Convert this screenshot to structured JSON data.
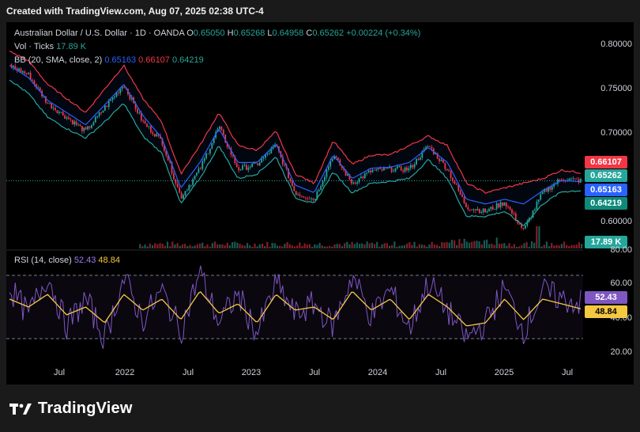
{
  "header": {
    "created_text": "Created with TradingView.com, Aug 07, 2025 02:38 UTC-4"
  },
  "legend": {
    "title": "Australian Dollar / U.S. Dollar · 1D · OANDA",
    "o_label": "O",
    "o_value": "0.65050",
    "h_label": "H",
    "h_value": "0.65268",
    "l_label": "L",
    "l_value": "0.64958",
    "c_label": "C",
    "c_value": "0.65262",
    "change": "+0.00224 (+0.34%)",
    "vol_label": "Vol · Ticks",
    "vol_value": "17.89 K",
    "bb_label": "BB (20, SMA, close, 2)",
    "bb_basis": "0.65163",
    "bb_upper": "0.66107",
    "bb_lower": "0.64219",
    "rsi_label": "RSI (14, close)",
    "rsi_value": "52.43",
    "rsi_ma": "48.84"
  },
  "price_axis": [
    "0.80000",
    "0.75000",
    "0.70000",
    "0.60000"
  ],
  "price_tags": {
    "upper": "0.66107",
    "close": "0.65262",
    "basis": "0.65163",
    "lower": "0.64219",
    "volume": "17.89 K"
  },
  "rsi_axis": [
    "80.00",
    "60.00",
    "40.00",
    "20.00"
  ],
  "rsi_tags": {
    "rsi": "52.43",
    "ma": "48.84"
  },
  "time_axis": [
    "Jul",
    "2022",
    "Jul",
    "2023",
    "Jul",
    "2024",
    "Jul",
    "2025",
    "Jul"
  ],
  "footer": {
    "brand": "TradingView"
  },
  "colors": {
    "up": "#26a69a",
    "down": "#f23645",
    "basis": "#2962ff",
    "rsi": "#7e57c2",
    "rsi_ma": "#f5c842",
    "bg": "#000000"
  },
  "chart_data": [
    {
      "type": "line",
      "title": "Australian Dollar / U.S. Dollar · 1D · OANDA",
      "x": [
        "2021-05",
        "2021-07",
        "2021-09",
        "2021-11",
        "2022-01",
        "2022-03",
        "2022-04",
        "2022-06",
        "2022-08",
        "2022-10",
        "2022-11",
        "2023-01",
        "2023-03",
        "2023-05",
        "2023-07",
        "2023-09",
        "2023-10",
        "2023-12",
        "2024-02",
        "2024-04",
        "2024-06",
        "2024-08",
        "2024-09",
        "2024-10",
        "2024-12",
        "2025-01",
        "2025-03",
        "2025-04",
        "2025-05",
        "2025-07",
        "2025-08"
      ],
      "series": [
        {
          "name": "Close",
          "values": [
            0.775,
            0.765,
            0.735,
            0.72,
            0.705,
            0.73,
            0.755,
            0.715,
            0.695,
            0.635,
            0.665,
            0.71,
            0.665,
            0.67,
            0.69,
            0.64,
            0.633,
            0.68,
            0.65,
            0.663,
            0.665,
            0.665,
            0.69,
            0.665,
            0.625,
            0.62,
            0.63,
            0.6,
            0.64,
            0.655,
            0.6526
          ]
        },
        {
          "name": "BB upper",
          "values": [
            0.79,
            0.78,
            0.755,
            0.74,
            0.725,
            0.75,
            0.775,
            0.74,
            0.715,
            0.66,
            0.69,
            0.725,
            0.69,
            0.685,
            0.705,
            0.66,
            0.65,
            0.695,
            0.67,
            0.68,
            0.68,
            0.69,
            0.7,
            0.69,
            0.65,
            0.64,
            0.645,
            0.65,
            0.655,
            0.664,
            0.6611
          ]
        },
        {
          "name": "BB basis",
          "values": [
            0.775,
            0.762,
            0.738,
            0.725,
            0.712,
            0.733,
            0.755,
            0.722,
            0.698,
            0.645,
            0.672,
            0.708,
            0.672,
            0.672,
            0.692,
            0.648,
            0.64,
            0.68,
            0.655,
            0.666,
            0.667,
            0.672,
            0.688,
            0.672,
            0.633,
            0.628,
            0.633,
            0.628,
            0.642,
            0.653,
            0.6516
          ]
        },
        {
          "name": "BB lower",
          "values": [
            0.76,
            0.745,
            0.72,
            0.708,
            0.698,
            0.715,
            0.735,
            0.7,
            0.682,
            0.628,
            0.655,
            0.69,
            0.655,
            0.66,
            0.678,
            0.635,
            0.628,
            0.662,
            0.64,
            0.65,
            0.652,
            0.655,
            0.675,
            0.655,
            0.615,
            0.615,
            0.62,
            0.605,
            0.628,
            0.641,
            0.6422
          ]
        }
      ],
      "ylim": [
        0.58,
        0.815
      ]
    },
    {
      "type": "bar",
      "title": "Vol · Ticks",
      "series": [
        {
          "name": "Volume",
          "values": [
            17890
          ]
        }
      ]
    },
    {
      "type": "line",
      "title": "RSI (14, close)",
      "series": [
        {
          "name": "RSI",
          "values": [
            62,
            45,
            70,
            38,
            55,
            30,
            68,
            42,
            60,
            35,
            72,
            40,
            58,
            33,
            65,
            45,
            52,
            38,
            70,
            44,
            61,
            36,
            66,
            48,
            30,
            40,
            62,
            35,
            60,
            55,
            52.43
          ]
        },
        {
          "name": "RSI MA",
          "values": [
            55,
            50,
            58,
            45,
            50,
            40,
            58,
            48,
            55,
            42,
            60,
            46,
            52,
            40,
            58,
            48,
            50,
            42,
            60,
            48,
            55,
            42,
            58,
            50,
            38,
            40,
            55,
            42,
            55,
            52,
            48.84
          ]
        }
      ],
      "ylim": [
        15,
        85
      ],
      "reference_lines": [
        70,
        30
      ]
    }
  ]
}
